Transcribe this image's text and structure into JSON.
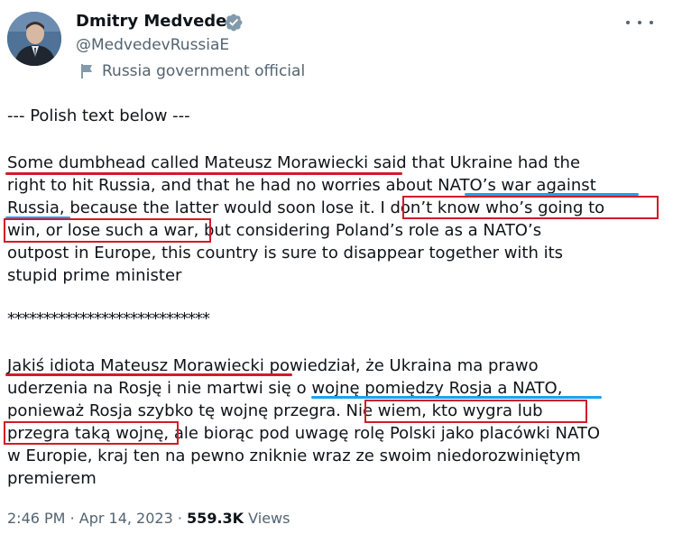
{
  "author": {
    "name": "Dmitry Medvedev",
    "handle": "@MedvedevRussiaE",
    "label": "Russia government official"
  },
  "tweet": {
    "lines": [
      "--- Polish text below ---",
      "Some dumbhead called Mateusz Morawiecki said that Ukraine had the",
      "right to hit Russia, and that he had no worries about NATO’s war against",
      "Russia, because the latter would soon lose it. I don’t know who’s going to",
      "win, or lose such a war, but considering Poland’s role as a NATO’s",
      "outpost in Europe, this country is sure to disappear together with its",
      "stupid prime minister",
      "****************************",
      "Jakiś idiota Mateusz Morawiecki powiedział, że Ukraina ma prawo",
      "uderzenia na Rosję i nie martwi się o wojnę pomiędzy Rosja a NATO,",
      "ponieważ Rosja szybko tę wojnę przegra. Nie wiem, kto wygra lub",
      "przegra taką wojnę, ale biorąc pod uwagę rolę Polski jako placówki NATO",
      "w Europie, kraj ten na pewno zniknie wraz ze swoim niedorozwiniętym",
      "premierem"
    ]
  },
  "meta": {
    "time": "2:46 PM",
    "date": "Apr 14, 2023",
    "views_count": "559.3K",
    "views_label": "Views"
  },
  "colors": {
    "annotation_red": "#d01c28",
    "annotation_blue": "#1da1f2",
    "verified_grey": "#829aab"
  },
  "icons": [
    "more-icon",
    "verified-badge-icon",
    "government-flag-icon"
  ]
}
